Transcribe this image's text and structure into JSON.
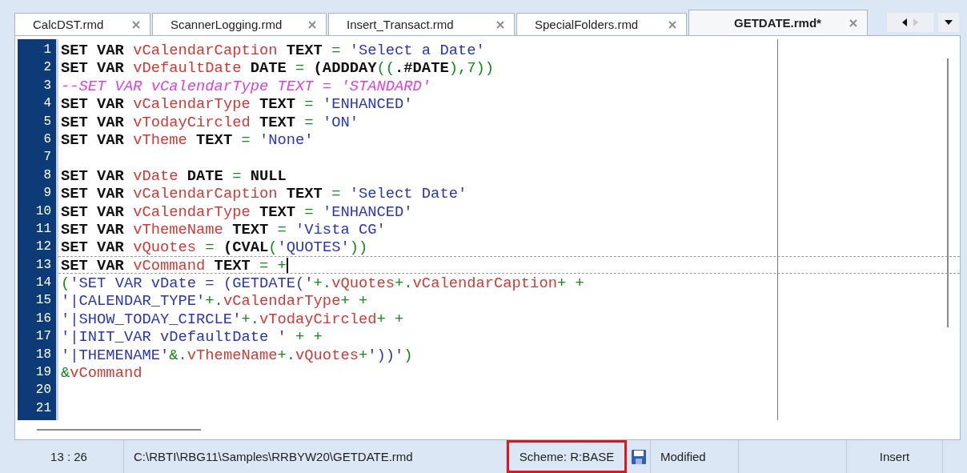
{
  "tabs": [
    {
      "label": "CalcDST.rmd",
      "selected": false
    },
    {
      "label": "ScannerLogging.rmd",
      "selected": false
    },
    {
      "label": "Insert_Transact.rmd",
      "selected": false
    },
    {
      "label": "SpecialFolders.rmd",
      "selected": false
    },
    {
      "label": "GETDATE.rmd*",
      "selected": true
    }
  ],
  "editor": {
    "lines": [
      {
        "number": "1",
        "current": false,
        "tokens": [
          {
            "kind": "kw",
            "text": "SET VAR "
          },
          {
            "kind": "var",
            "text": "vCalendarCaption"
          },
          {
            "kind": "kw",
            "text": " TEXT "
          },
          {
            "kind": "op",
            "text": "= "
          },
          {
            "kind": "str",
            "text": "'Select a Date'"
          }
        ]
      },
      {
        "number": "2",
        "current": false,
        "tokens": [
          {
            "kind": "kw",
            "text": "SET VAR "
          },
          {
            "kind": "var",
            "text": "vDefaultDate"
          },
          {
            "kind": "kw",
            "text": " DATE "
          },
          {
            "kind": "op",
            "text": "= "
          },
          {
            "kind": "kw",
            "text": "(ADDDAY"
          },
          {
            "kind": "op",
            "text": "(("
          },
          {
            "kind": "kw",
            "text": ".#DATE"
          },
          {
            "kind": "op",
            "text": "),"
          },
          {
            "kind": "num",
            "text": "7"
          },
          {
            "kind": "op",
            "text": "))"
          }
        ]
      },
      {
        "number": "3",
        "current": false,
        "tokens": [
          {
            "kind": "cmt",
            "text": "--SET VAR vCalendarType TEXT = 'STANDARD'"
          }
        ]
      },
      {
        "number": "4",
        "current": false,
        "tokens": [
          {
            "kind": "kw",
            "text": "SET VAR "
          },
          {
            "kind": "var",
            "text": "vCalendarType"
          },
          {
            "kind": "kw",
            "text": " TEXT "
          },
          {
            "kind": "op",
            "text": "= "
          },
          {
            "kind": "str",
            "text": "'ENHANCED'"
          }
        ]
      },
      {
        "number": "5",
        "current": false,
        "tokens": [
          {
            "kind": "kw",
            "text": "SET VAR "
          },
          {
            "kind": "var",
            "text": "vTodayCircled"
          },
          {
            "kind": "kw",
            "text": " TEXT "
          },
          {
            "kind": "op",
            "text": "= "
          },
          {
            "kind": "str",
            "text": "'ON'"
          }
        ]
      },
      {
        "number": "6",
        "current": false,
        "tokens": [
          {
            "kind": "kw",
            "text": "SET VAR "
          },
          {
            "kind": "var",
            "text": "vTheme"
          },
          {
            "kind": "kw",
            "text": " TEXT "
          },
          {
            "kind": "op",
            "text": "= "
          },
          {
            "kind": "str",
            "text": "'None'"
          }
        ]
      },
      {
        "number": "7",
        "current": false
      },
      {
        "number": "8",
        "current": false,
        "tokens": [
          {
            "kind": "kw",
            "text": "SET VAR "
          },
          {
            "kind": "var",
            "text": "vDate"
          },
          {
            "kind": "kw",
            "text": " DATE "
          },
          {
            "kind": "op",
            "text": "= "
          },
          {
            "kind": "kw",
            "text": "NULL"
          }
        ]
      },
      {
        "number": "9",
        "current": false,
        "tokens": [
          {
            "kind": "kw",
            "text": "SET VAR "
          },
          {
            "kind": "var",
            "text": "vCalendarCaption"
          },
          {
            "kind": "kw",
            "text": " TEXT "
          },
          {
            "kind": "op",
            "text": "= "
          },
          {
            "kind": "str",
            "text": "'Select Date'"
          }
        ]
      },
      {
        "number": "10",
        "current": false,
        "tokens": [
          {
            "kind": "kw",
            "text": "SET VAR "
          },
          {
            "kind": "var",
            "text": "vCalendarType"
          },
          {
            "kind": "kw",
            "text": " TEXT "
          },
          {
            "kind": "op",
            "text": "= "
          },
          {
            "kind": "str",
            "text": "'ENHANCED'"
          }
        ]
      },
      {
        "number": "11",
        "current": false,
        "tokens": [
          {
            "kind": "kw",
            "text": "SET VAR "
          },
          {
            "kind": "var",
            "text": "vThemeName"
          },
          {
            "kind": "kw",
            "text": " TEXT "
          },
          {
            "kind": "op",
            "text": "= "
          },
          {
            "kind": "str",
            "text": "'Vista CG'"
          }
        ]
      },
      {
        "number": "12",
        "current": false,
        "tokens": [
          {
            "kind": "kw",
            "text": "SET VAR "
          },
          {
            "kind": "var",
            "text": "vQuotes"
          },
          {
            "kind": "op",
            "text": " = "
          },
          {
            "kind": "kw",
            "text": "(CVAL"
          },
          {
            "kind": "op",
            "text": "("
          },
          {
            "kind": "str",
            "text": "'QUOTES'"
          },
          {
            "kind": "op",
            "text": "))"
          }
        ]
      },
      {
        "number": "13",
        "current": true,
        "tokens": [
          {
            "kind": "kw",
            "text": "SET VAR "
          },
          {
            "kind": "var",
            "text": "vCommand"
          },
          {
            "kind": "kw",
            "text": " TEXT "
          },
          {
            "kind": "op",
            "text": "= +"
          }
        ]
      },
      {
        "number": "14",
        "current": false,
        "tokens": [
          {
            "kind": "op",
            "text": "("
          },
          {
            "kind": "str",
            "text": "'SET VAR vDate = (GETDATE('"
          },
          {
            "kind": "op",
            "text": "+."
          },
          {
            "kind": "var",
            "text": "vQuotes"
          },
          {
            "kind": "op",
            "text": "+."
          },
          {
            "kind": "var",
            "text": "vCalendarCaption"
          },
          {
            "kind": "op",
            "text": "+ +"
          }
        ]
      },
      {
        "number": "15",
        "current": false,
        "tokens": [
          {
            "kind": "str",
            "text": "'|CALENDAR_TYPE'"
          },
          {
            "kind": "op",
            "text": "+."
          },
          {
            "kind": "var",
            "text": "vCalendarType"
          },
          {
            "kind": "op",
            "text": "+ +"
          }
        ]
      },
      {
        "number": "16",
        "current": false,
        "tokens": [
          {
            "kind": "str",
            "text": "'|SHOW_TODAY_CIRCLE'"
          },
          {
            "kind": "op",
            "text": "+."
          },
          {
            "kind": "var",
            "text": "vTodayCircled"
          },
          {
            "kind": "op",
            "text": "+ +"
          }
        ]
      },
      {
        "number": "17",
        "current": false,
        "tokens": [
          {
            "kind": "str",
            "text": "'|INIT_VAR vDefaultDate '"
          },
          {
            "kind": "op",
            "text": " + +"
          }
        ]
      },
      {
        "number": "18",
        "current": false,
        "tokens": [
          {
            "kind": "str",
            "text": "'|THEMENAME'"
          },
          {
            "kind": "op",
            "text": "&."
          },
          {
            "kind": "var",
            "text": "vThemeName"
          },
          {
            "kind": "op",
            "text": "+."
          },
          {
            "kind": "var",
            "text": "vQuotes"
          },
          {
            "kind": "op",
            "text": "+"
          },
          {
            "kind": "str",
            "text": "'))'"
          },
          {
            "kind": "op",
            "text": ")"
          }
        ]
      },
      {
        "number": "19",
        "current": false,
        "tokens": [
          {
            "kind": "op",
            "text": "&"
          },
          {
            "kind": "var",
            "text": "vCommand"
          }
        ]
      },
      {
        "number": "20",
        "current": false
      },
      {
        "number": "21",
        "current": false
      }
    ]
  },
  "status_bar": {
    "cursor": "13 : 26",
    "path": "C:\\RBTI\\RBG11\\Samples\\RRBYW20\\GETDATE.rmd",
    "scheme": "Scheme: R:BASE",
    "state": "Modified",
    "mode": "Insert"
  }
}
